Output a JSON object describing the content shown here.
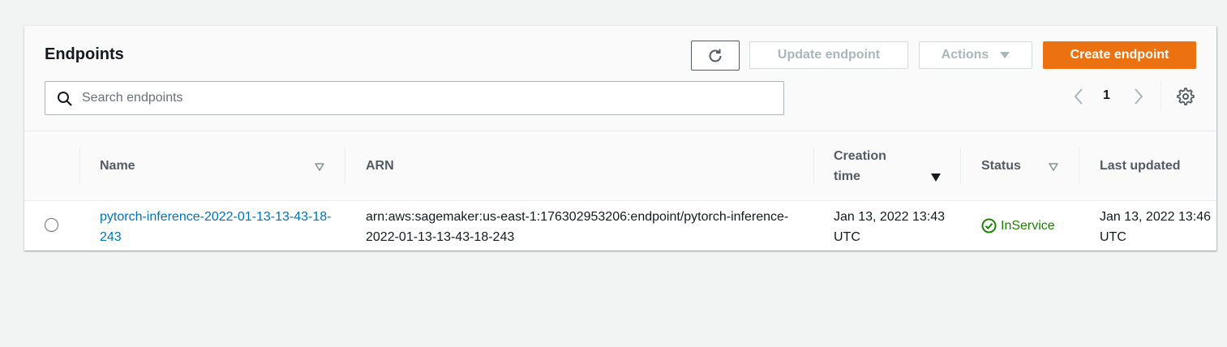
{
  "header": {
    "title": "Endpoints",
    "refresh_icon": "refresh-icon",
    "update_label": "Update endpoint",
    "actions_label": "Actions",
    "create_label": "Create endpoint"
  },
  "search": {
    "placeholder": "Search endpoints",
    "value": "",
    "icon": "search-icon"
  },
  "pagination": {
    "current_page": "1",
    "prev_icon": "chevron-left-icon",
    "next_icon": "chevron-right-icon",
    "settings_icon": "gear-icon"
  },
  "table": {
    "columns": [
      {
        "label": "Name",
        "sortable": true
      },
      {
        "label": "ARN",
        "sortable": false
      },
      {
        "label": "Creation time",
        "sortable": true,
        "sorted": "descending"
      },
      {
        "label": "Status",
        "sortable": true
      },
      {
        "label": "Last updated",
        "sortable": false
      }
    ],
    "rows": [
      {
        "selected": false,
        "name": "pytorch-inference-2022-01-13-13-43-18-243",
        "arn": "arn:aws:sagemaker:us-east-1:176302953206:endpoint/pytorch-inference-2022-01-13-13-43-18-243",
        "creation_time": "Jan 13, 2022 13:43 UTC",
        "status": "InService",
        "status_icon": "check-circle-icon",
        "last_updated": "Jan 13, 2022 13:46 UTC"
      }
    ]
  },
  "colors": {
    "primary": "#ec7211",
    "link": "#0073bb",
    "success": "#1d8102",
    "disabled": "#aab7b8",
    "background": "#f2f3f3"
  }
}
